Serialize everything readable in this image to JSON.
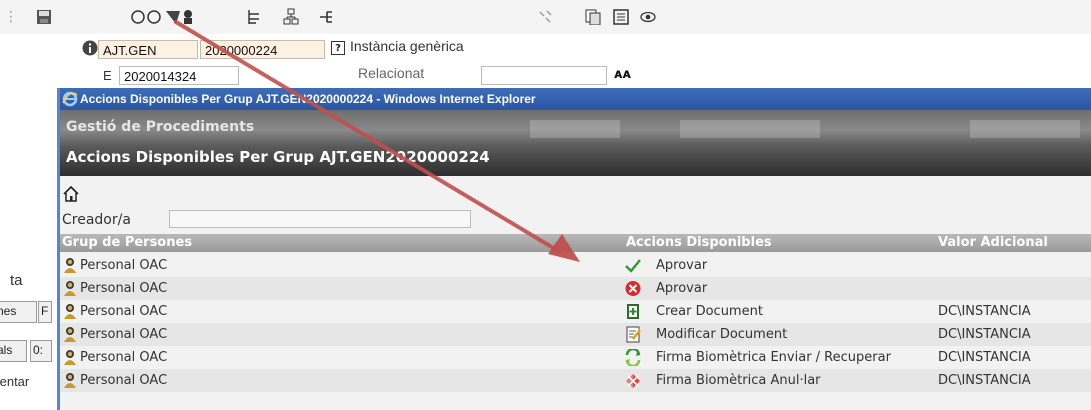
{
  "toolbar": {
    "icons": [
      "save-icon",
      "people-search-icon",
      "tree-icon",
      "structure-icon",
      "branch-icon",
      "key-icon",
      "copy-icon",
      "list-icon",
      "eye-icon"
    ]
  },
  "background_form": {
    "code_field": "AJT.GEN",
    "number_field": "2020000224",
    "instance_label": "Instància genèrica",
    "e_label": "E",
    "e_field": "2020014324",
    "related_label": "Relacionat",
    "side_fragments": [
      "ta",
      "nes",
      "F",
      "als",
      "0:",
      ":entar"
    ]
  },
  "window": {
    "title": "Accions Disponibles Per Grup AJT.GEN2020000224 - Windows Internet Explorer",
    "banner_title": "Gestió de Procediments",
    "banner_subtitle": "Accions Disponibles Per Grup AJT.GEN2020000224",
    "creator_label": "Creador/a",
    "creator_value": "",
    "columns": {
      "group": "Grup de Persones",
      "actions": "Accions Disponibles",
      "extra": "Valor Adicional"
    },
    "rows": [
      {
        "group": "Personal OAC",
        "action_icon": "check-icon",
        "action": "Aprovar",
        "extra": ""
      },
      {
        "group": "Personal OAC",
        "action_icon": "reject-icon",
        "action": "Aprovar",
        "extra": ""
      },
      {
        "group": "Personal OAC",
        "action_icon": "create-document-icon",
        "action": "Crear Document",
        "extra": "DC\\INSTANCIA"
      },
      {
        "group": "Personal OAC",
        "action_icon": "edit-document-icon",
        "action": "Modificar Document",
        "extra": "DC\\INSTANCIA"
      },
      {
        "group": "Personal OAC",
        "action_icon": "biometric-sign-icon",
        "action": "Firma Biomètrica Enviar / Recuperar",
        "extra": "DC\\INSTANCIA"
      },
      {
        "group": "Personal OAC",
        "action_icon": "biometric-cancel-icon",
        "action": "Firma Biomètrica Anul·lar",
        "extra": "DC\\INSTANCIA"
      }
    ]
  },
  "colors": {
    "title_bar": "#2f5fae",
    "table_header": "#a8a8a8",
    "arrow": "#c0504d",
    "field_background": "#fdf1e4"
  }
}
